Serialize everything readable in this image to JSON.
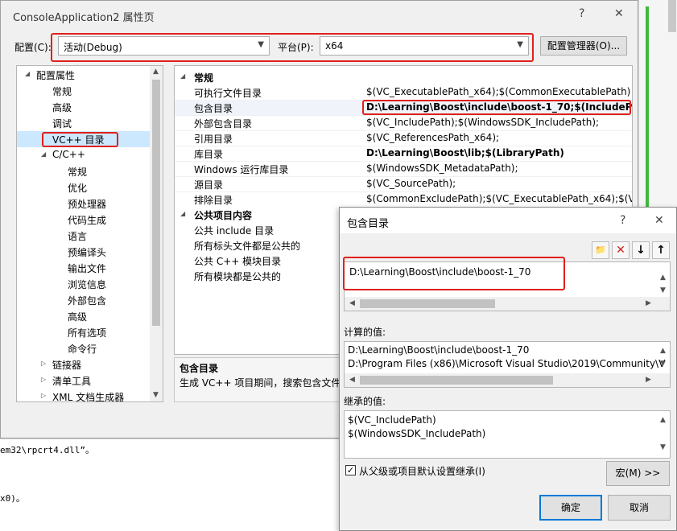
{
  "main": {
    "title": "ConsoleApplication2 属性页",
    "help_glyph": "?",
    "close_glyph": "✕",
    "config_label": "配置(C):",
    "config_value": "活动(Debug)",
    "platform_label": "平台(P):",
    "platform_value": "x64",
    "config_manager_label": "配置管理器(O)..."
  },
  "tree": {
    "root": "配置属性",
    "items": [
      "常规",
      "高级",
      "调试",
      "VC++ 目录",
      "C/C++"
    ],
    "cpp_children": [
      "常规",
      "优化",
      "预处理器",
      "代码生成",
      "语言",
      "预编译头",
      "输出文件",
      "浏览信息",
      "外部包含",
      "高级",
      "所有选项",
      "命令行"
    ],
    "bottom": [
      "链接器",
      "清单工具",
      "XML 文档生成器"
    ]
  },
  "grid": {
    "cat_general": "常规",
    "props": [
      {
        "name": "可执行文件目录",
        "value": "$(VC_ExecutablePath_x64);$(CommonExecutablePath)"
      },
      {
        "name": "包含目录",
        "value": "D:\\Learning\\Boost\\include\\boost-1_70;$(IncludePath)"
      },
      {
        "name": "外部包含目录",
        "value": "$(VC_IncludePath);$(WindowsSDK_IncludePath);"
      },
      {
        "name": "引用目录",
        "value": "$(VC_ReferencesPath_x64);"
      },
      {
        "name": "库目录",
        "value": "D:\\Learning\\Boost\\lib;$(LibraryPath)"
      },
      {
        "name": "Windows 运行库目录",
        "value": "$(WindowsSDK_MetadataPath);"
      },
      {
        "name": "源目录",
        "value": "$(VC_SourcePath);"
      },
      {
        "name": "排除目录",
        "value": "$(CommonExcludePath);$(VC_ExecutablePath_x64);$(VC_L"
      }
    ],
    "cat_public": "公共项目内容",
    "public_props": [
      "公共 include 目录",
      "所有标头文件都是公共的",
      "公共 C++ 模块目录",
      "所有模块都是公共的"
    ]
  },
  "desc": {
    "title": "包含目录",
    "text": "生成 VC++ 项目期间，搜索包含文件时"
  },
  "dialog": {
    "title": "包含目录",
    "help_glyph": "?",
    "close_glyph": "✕",
    "new_line_glyph": "📁",
    "delete_glyph": "✕",
    "down_glyph": "↓",
    "up_glyph": "↑",
    "edit_value": "D:\\Learning\\Boost\\include\\boost-1_70",
    "computed_label": "计算的值:",
    "computed_lines": [
      "D:\\Learning\\Boost\\include\\boost-1_70",
      "D:\\Program Files (x86)\\Microsoft Visual Studio\\2019\\Community\\V"
    ],
    "inherited_label": "继承的值:",
    "inherited_lines": [
      "$(VC_IncludePath)",
      "$(WindowsSDK_IncludePath)"
    ],
    "inherit_checkbox_label": "从父级或项目默认设置继承(I)",
    "macro_button": "宏(M) >>",
    "ok_button": "确定",
    "cancel_button": "取消"
  },
  "bg": {
    "code_line_1": "em32\\rpcrt4.dll”。",
    "code_line_2": "x0)。",
    "left_frag_1": "st",
    "left_frag_2": "ad"
  }
}
